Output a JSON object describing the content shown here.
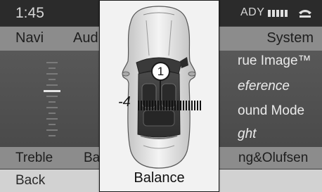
{
  "status": {
    "time": "1:45",
    "status_text": "ADY",
    "signal_bars": 5
  },
  "menu": {
    "items": [
      "Navi",
      "Aud",
      "System"
    ]
  },
  "right_menu": {
    "items": [
      "rue Image™",
      "eference",
      "ound Mode",
      "ght"
    ]
  },
  "bottom": {
    "items": [
      "Treble",
      "Ba",
      "ng&Olufsen"
    ],
    "back_label": "Back"
  },
  "balance_overlay": {
    "title": "Balance",
    "value": "-4",
    "callout": "1"
  }
}
